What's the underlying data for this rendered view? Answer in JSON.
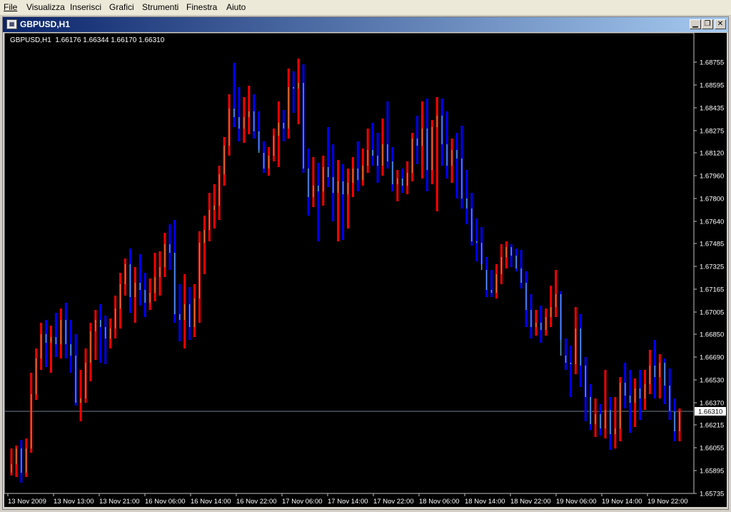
{
  "menu": [
    "File",
    "Visualizza",
    "Inserisci",
    "Grafici",
    "Strumenti",
    "Finestra",
    "Aiuto"
  ],
  "window": {
    "title": "GBPUSD,H1",
    "icon": "chart-window-icon",
    "buttons": {
      "minimize": "minimize-icon",
      "restore": "restore-icon",
      "close": "close-icon"
    }
  },
  "chart_info": "GBPUSD,H1  1.66176 1.66344 1.66170 1.66310",
  "current_price": "1.66310",
  "colors": {
    "bull": "#ff0000",
    "bear": "#0000ff",
    "bull_body": "#c87832",
    "bear_body": "#5aa0c8",
    "background": "#000000",
    "price_line": "#708090"
  },
  "chart_data": {
    "type": "candlestick-bars",
    "symbol": "GBPUSD",
    "timeframe": "H1",
    "ylim": [
      1.65735,
      1.6891
    ],
    "y_ticks": [
      "1.68755",
      "1.68595",
      "1.68435",
      "1.68275",
      "1.68120",
      "1.67960",
      "1.67800",
      "1.67640",
      "1.67485",
      "1.67325",
      "1.67165",
      "1.67005",
      "1.66850",
      "1.66690",
      "1.66530",
      "1.66370",
      "1.66215",
      "1.66055",
      "1.65895",
      "1.65735"
    ],
    "x_ticks": [
      "13 Nov 2009",
      "13 Nov 13:00",
      "13 Nov 21:00",
      "16 Nov 06:00",
      "16 Nov 14:00",
      "16 Nov 22:00",
      "17 Nov 06:00",
      "17 Nov 14:00",
      "17 Nov 22:00",
      "18 Nov 06:00",
      "18 Nov 14:00",
      "18 Nov 22:00",
      "19 Nov 06:00",
      "19 Nov 14:00",
      "19 Nov 22:00"
    ],
    "bars": [
      [
        1.6588,
        1.6605,
        1.6586,
        1.6594
      ],
      [
        1.6594,
        1.6607,
        1.6585,
        1.6605
      ],
      [
        1.6605,
        1.6611,
        1.6581,
        1.6588
      ],
      [
        1.6588,
        1.6612,
        1.6585,
        1.6605
      ],
      [
        1.6605,
        1.6658,
        1.6602,
        1.6643
      ],
      [
        1.6643,
        1.6675,
        1.6639,
        1.6668
      ],
      [
        1.6668,
        1.6693,
        1.666,
        1.6685
      ],
      [
        1.6685,
        1.6695,
        1.6662,
        1.6679
      ],
      [
        1.6679,
        1.6691,
        1.6658,
        1.6683
      ],
      [
        1.6683,
        1.67,
        1.6669,
        1.6678
      ],
      [
        1.6678,
        1.6703,
        1.6668,
        1.6695
      ],
      [
        1.6695,
        1.6707,
        1.6668,
        1.6678
      ],
      [
        1.6678,
        1.6695,
        1.6658,
        1.667
      ],
      [
        1.667,
        1.6685,
        1.6635,
        1.6637
      ],
      [
        1.6637,
        1.666,
        1.6624,
        1.664
      ],
      [
        1.664,
        1.6675,
        1.6637,
        1.6665
      ],
      [
        1.6665,
        1.6693,
        1.6652,
        1.6687
      ],
      [
        1.6687,
        1.6702,
        1.6667,
        1.6695
      ],
      [
        1.6695,
        1.6706,
        1.6665,
        1.669
      ],
      [
        1.669,
        1.6698,
        1.6664,
        1.6682
      ],
      [
        1.6682,
        1.6696,
        1.6675,
        1.6689
      ],
      [
        1.6689,
        1.6712,
        1.6682,
        1.6703
      ],
      [
        1.6703,
        1.6728,
        1.6689,
        1.672
      ],
      [
        1.672,
        1.6738,
        1.6712,
        1.6734
      ],
      [
        1.6734,
        1.6745,
        1.67,
        1.6711
      ],
      [
        1.6711,
        1.6732,
        1.6693,
        1.6721
      ],
      [
        1.6721,
        1.6741,
        1.6705,
        1.6716
      ],
      [
        1.6716,
        1.6728,
        1.6697,
        1.6707
      ],
      [
        1.6707,
        1.6724,
        1.6702,
        1.6714
      ],
      [
        1.6714,
        1.6742,
        1.6708,
        1.6725
      ],
      [
        1.6725,
        1.6743,
        1.6712,
        1.6732
      ],
      [
        1.6732,
        1.6756,
        1.6725,
        1.6748
      ],
      [
        1.6748,
        1.6762,
        1.673,
        1.6742
      ],
      [
        1.6742,
        1.6765,
        1.6693,
        1.6699
      ],
      [
        1.6699,
        1.672,
        1.668,
        1.6695
      ],
      [
        1.6695,
        1.6727,
        1.6675,
        1.6706
      ],
      [
        1.6706,
        1.6718,
        1.6681,
        1.669
      ],
      [
        1.669,
        1.672,
        1.6683,
        1.671
      ],
      [
        1.671,
        1.6757,
        1.6693,
        1.6749
      ],
      [
        1.6749,
        1.6768,
        1.6727,
        1.6758
      ],
      [
        1.6758,
        1.6784,
        1.675,
        1.6772
      ],
      [
        1.6772,
        1.679,
        1.6759,
        1.6775
      ],
      [
        1.6775,
        1.6803,
        1.6765,
        1.6797
      ],
      [
        1.6797,
        1.6823,
        1.6789,
        1.6817
      ],
      [
        1.6817,
        1.6853,
        1.681,
        1.6843
      ],
      [
        1.6843,
        1.6875,
        1.683,
        1.6837
      ],
      [
        1.6837,
        1.6858,
        1.682,
        1.6829
      ],
      [
        1.6829,
        1.6851,
        1.6819,
        1.6837
      ],
      [
        1.6837,
        1.6859,
        1.6825,
        1.6841
      ],
      [
        1.6841,
        1.6853,
        1.6822,
        1.6827
      ],
      [
        1.6827,
        1.6841,
        1.6814,
        1.6812
      ],
      [
        1.6812,
        1.682,
        1.6798,
        1.6801
      ],
      [
        1.6801,
        1.6816,
        1.6796,
        1.681
      ],
      [
        1.681,
        1.6829,
        1.6806,
        1.6824
      ],
      [
        1.6824,
        1.6848,
        1.6802,
        1.6833
      ],
      [
        1.6833,
        1.6842,
        1.682,
        1.6829
      ],
      [
        1.6829,
        1.6871,
        1.6822,
        1.6858
      ],
      [
        1.6858,
        1.6869,
        1.684,
        1.6857
      ],
      [
        1.6857,
        1.6878,
        1.6832,
        1.6861
      ],
      [
        1.6861,
        1.6874,
        1.6798,
        1.6801
      ],
      [
        1.6801,
        1.6815,
        1.6768,
        1.6781
      ],
      [
        1.6781,
        1.6809,
        1.6774,
        1.6789
      ],
      [
        1.6789,
        1.6805,
        1.675,
        1.6785
      ],
      [
        1.6785,
        1.681,
        1.6775,
        1.6802
      ],
      [
        1.6802,
        1.683,
        1.6788,
        1.6795
      ],
      [
        1.6795,
        1.6818,
        1.6764,
        1.6784
      ],
      [
        1.6784,
        1.6807,
        1.675,
        1.6792
      ],
      [
        1.6792,
        1.6804,
        1.6751,
        1.6783
      ],
      [
        1.6783,
        1.6801,
        1.6759,
        1.6791
      ],
      [
        1.6791,
        1.6809,
        1.6781,
        1.6801
      ],
      [
        1.6801,
        1.682,
        1.6785,
        1.6793
      ],
      [
        1.6793,
        1.6815,
        1.6789,
        1.6803
      ],
      [
        1.6803,
        1.6829,
        1.6798,
        1.6814
      ],
      [
        1.6814,
        1.6833,
        1.6803,
        1.681
      ],
      [
        1.681,
        1.6826,
        1.6791,
        1.6803
      ],
      [
        1.6803,
        1.6836,
        1.6796,
        1.6818
      ],
      [
        1.6818,
        1.6848,
        1.6801,
        1.6806
      ],
      [
        1.6806,
        1.6816,
        1.6785,
        1.679
      ],
      [
        1.679,
        1.68,
        1.6778,
        1.6794
      ],
      [
        1.6794,
        1.6801,
        1.6784,
        1.6789
      ],
      [
        1.6789,
        1.6806,
        1.6783,
        1.6798
      ],
      [
        1.6798,
        1.6826,
        1.6792,
        1.6822
      ],
      [
        1.6822,
        1.6838,
        1.6804,
        1.6817
      ],
      [
        1.6817,
        1.6848,
        1.6794,
        1.6829
      ],
      [
        1.6829,
        1.685,
        1.6785,
        1.68
      ],
      [
        1.68,
        1.6835,
        1.679,
        1.683
      ],
      [
        1.683,
        1.6851,
        1.6771,
        1.6838
      ],
      [
        1.6838,
        1.685,
        1.6803,
        1.6818
      ],
      [
        1.6818,
        1.6841,
        1.6794,
        1.6803
      ],
      [
        1.6803,
        1.6822,
        1.6791,
        1.6814
      ],
      [
        1.6814,
        1.6826,
        1.678,
        1.6808
      ],
      [
        1.6808,
        1.6831,
        1.6773,
        1.678
      ],
      [
        1.678,
        1.68,
        1.6762,
        1.6773
      ],
      [
        1.6773,
        1.6784,
        1.6747,
        1.675
      ],
      [
        1.675,
        1.6766,
        1.6736,
        1.6749
      ],
      [
        1.6749,
        1.676,
        1.6734,
        1.673
      ],
      [
        1.673,
        1.6739,
        1.6711,
        1.6716
      ],
      [
        1.6716,
        1.673,
        1.6711,
        1.6714
      ],
      [
        1.6714,
        1.6734,
        1.671,
        1.6727
      ],
      [
        1.6727,
        1.6748,
        1.672,
        1.6739
      ],
      [
        1.6739,
        1.675,
        1.6731,
        1.6746
      ],
      [
        1.6746,
        1.6748,
        1.6732,
        1.674
      ],
      [
        1.674,
        1.6745,
        1.6729,
        1.6731
      ],
      [
        1.6731,
        1.6744,
        1.6717,
        1.6721
      ],
      [
        1.6721,
        1.6729,
        1.669,
        1.6702
      ],
      [
        1.6702,
        1.6713,
        1.6682,
        1.669
      ],
      [
        1.669,
        1.6702,
        1.6684,
        1.6693
      ],
      [
        1.6693,
        1.6705,
        1.6679,
        1.6688
      ],
      [
        1.6688,
        1.6703,
        1.6684,
        1.6697
      ],
      [
        1.6697,
        1.6719,
        1.669,
        1.6704
      ],
      [
        1.6704,
        1.673,
        1.6697,
        1.6713
      ],
      [
        1.6713,
        1.6715,
        1.6681,
        1.667
      ],
      [
        1.667,
        1.6682,
        1.666,
        1.6665
      ],
      [
        1.6665,
        1.6677,
        1.6641,
        1.6664
      ],
      [
        1.6664,
        1.6704,
        1.6657,
        1.6689
      ],
      [
        1.6689,
        1.6699,
        1.6648,
        1.6663
      ],
      [
        1.6663,
        1.6669,
        1.6624,
        1.6641
      ],
      [
        1.6641,
        1.665,
        1.6618,
        1.6622
      ],
      [
        1.6622,
        1.664,
        1.6613,
        1.6629
      ],
      [
        1.6629,
        1.6636,
        1.6614,
        1.6619
      ],
      [
        1.6619,
        1.666,
        1.6612,
        1.6632
      ],
      [
        1.6632,
        1.6641,
        1.6604,
        1.6615
      ],
      [
        1.6615,
        1.6641,
        1.6605,
        1.6619
      ],
      [
        1.6619,
        1.6655,
        1.661,
        1.6651
      ],
      [
        1.6651,
        1.6665,
        1.6633,
        1.6642
      ],
      [
        1.6642,
        1.666,
        1.6616,
        1.6637
      ],
      [
        1.6637,
        1.6654,
        1.662,
        1.6647
      ],
      [
        1.6647,
        1.666,
        1.6625,
        1.664
      ],
      [
        1.664,
        1.666,
        1.6632,
        1.665
      ],
      [
        1.665,
        1.6674,
        1.6643,
        1.6663
      ],
      [
        1.6663,
        1.6681,
        1.664,
        1.6655
      ],
      [
        1.6655,
        1.6671,
        1.664,
        1.6665
      ],
      [
        1.6665,
        1.6668,
        1.6636,
        1.6649
      ],
      [
        1.6649,
        1.6661,
        1.6625,
        1.6631
      ],
      [
        1.6631,
        1.664,
        1.661,
        1.6617
      ],
      [
        1.6617,
        1.6633,
        1.661,
        1.6631
      ]
    ]
  }
}
